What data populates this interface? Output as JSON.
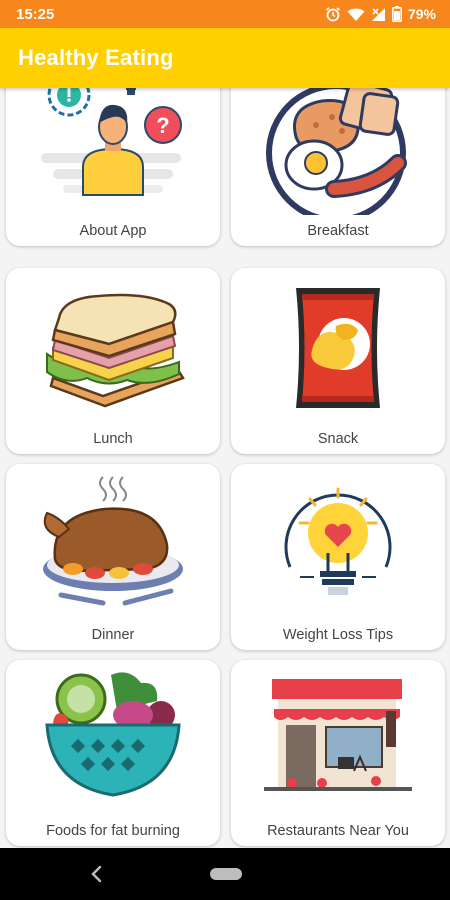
{
  "status_bar": {
    "time": "15:25",
    "battery": "79%"
  },
  "app_bar": {
    "title": "Healthy Eating"
  },
  "cards": [
    {
      "label": "About App",
      "icon": "person-question-icon"
    },
    {
      "label": "Breakfast",
      "icon": "breakfast-plate-icon"
    },
    {
      "label": "Lunch",
      "icon": "sandwich-icon"
    },
    {
      "label": "Snack",
      "icon": "chips-bag-icon"
    },
    {
      "label": "Dinner",
      "icon": "roast-chicken-icon"
    },
    {
      "label": "Weight Loss Tips",
      "icon": "lightbulb-heart-icon"
    },
    {
      "label": "Foods for fat burning",
      "icon": "vegetable-bowl-icon"
    },
    {
      "label": "Restaurants Near You",
      "icon": "restaurant-building-icon"
    }
  ],
  "colors": {
    "status_bar": "#f7861c",
    "app_bar": "#ffcf00",
    "nav_bar": "#000000"
  }
}
